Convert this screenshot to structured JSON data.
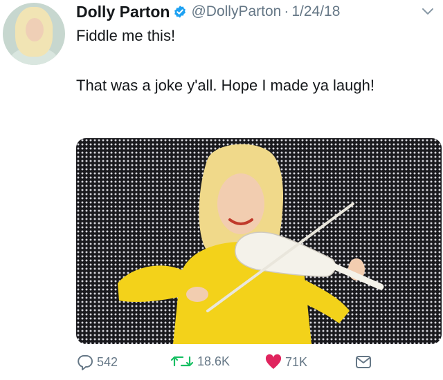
{
  "tweet": {
    "author_name": "Dolly Parton",
    "handle": "@DollyParton",
    "separator": "·",
    "date": "1/24/18",
    "line1": "Fiddle me this!",
    "line2": "That was a joke y'all. Hope I made ya laugh!"
  },
  "actions": {
    "replies": "542",
    "retweets": "18.6K",
    "likes": "71K"
  },
  "icons": {
    "verified": "verified-badge-icon",
    "caret": "chevron-down-icon",
    "reply": "reply-icon",
    "retweet": "retweet-icon",
    "like": "heart-icon",
    "dm": "direct-message-icon"
  },
  "colors": {
    "verified": "#1da1f2",
    "retweet": "#17bf63",
    "like": "#e0245e",
    "muted": "#657786"
  }
}
